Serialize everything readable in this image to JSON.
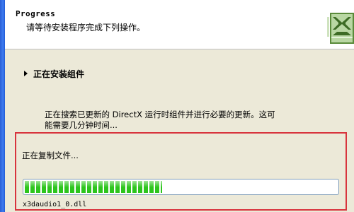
{
  "header": {
    "title": "Progress",
    "subtitle": "请等待安装程序完成下列操作。",
    "logo_icon": "directx-logo-icon"
  },
  "section": {
    "heading": "正在安装组件",
    "description": "正在搜索已更新的 DirectX 运行时组件并进行必要的更新。这可能需要几分钟时间..."
  },
  "progress": {
    "status": "正在复制文件...",
    "fraction": 0.44,
    "current_file": "x3daudio1_0.dll"
  },
  "colors": {
    "highlight_border": "#d8343d",
    "progress_fill": "#2dc51d",
    "window_background": "#ece9d8"
  }
}
